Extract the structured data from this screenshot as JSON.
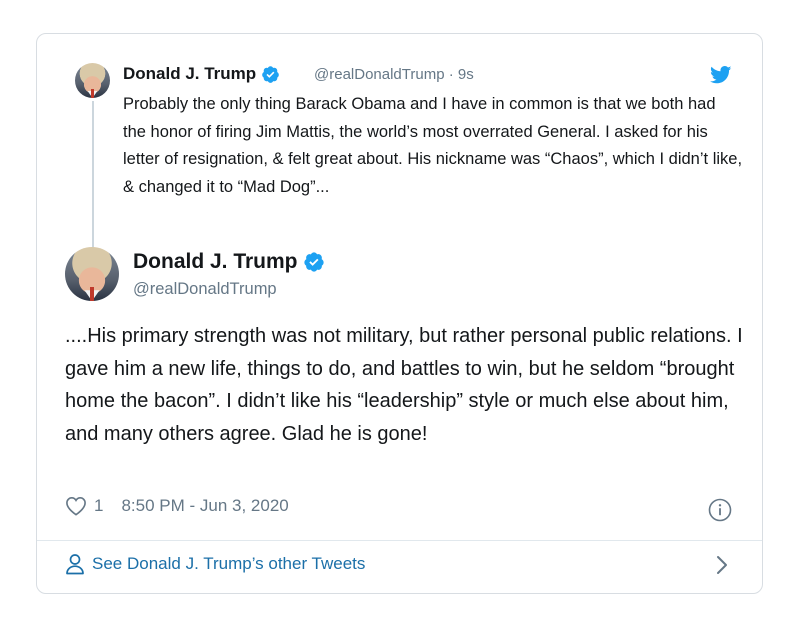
{
  "quoted_tweet": {
    "author_name": "Donald J. Trump",
    "handle_time": "@realDonaldTrump · 9s",
    "text": "Probably the only thing Barack Obama and I have in common is that we both had the honor of firing Jim Mattis, the world’s most overrated General. I asked for his letter of resignation, & felt great about. His nickname was “Chaos”, which I didn’t like, & changed it to “Mad Dog”..."
  },
  "main_tweet": {
    "author_name": "Donald J. Trump",
    "handle": "@realDonaldTrump",
    "text": "....His primary strength was not military, but rather personal public relations. I gave him a new life, things to do, and battles to win, but he seldom “brought home the bacon”. I didn’t like his “leadership” style or much else about him, and many others agree. Glad he is gone!",
    "like_count": "1",
    "timestamp": "8:50 PM - Jun 3, 2020"
  },
  "footer": {
    "see_more_label": "See Donald J. Trump’s other Tweets"
  },
  "colors": {
    "verified_blue": "#1da1f2",
    "link_blue": "#1b6fa8",
    "muted_gray": "#657786"
  },
  "icons": [
    "verified-badge-icon",
    "twitter-bird-icon",
    "heart-icon",
    "info-icon",
    "person-icon",
    "chevron-right-icon"
  ]
}
